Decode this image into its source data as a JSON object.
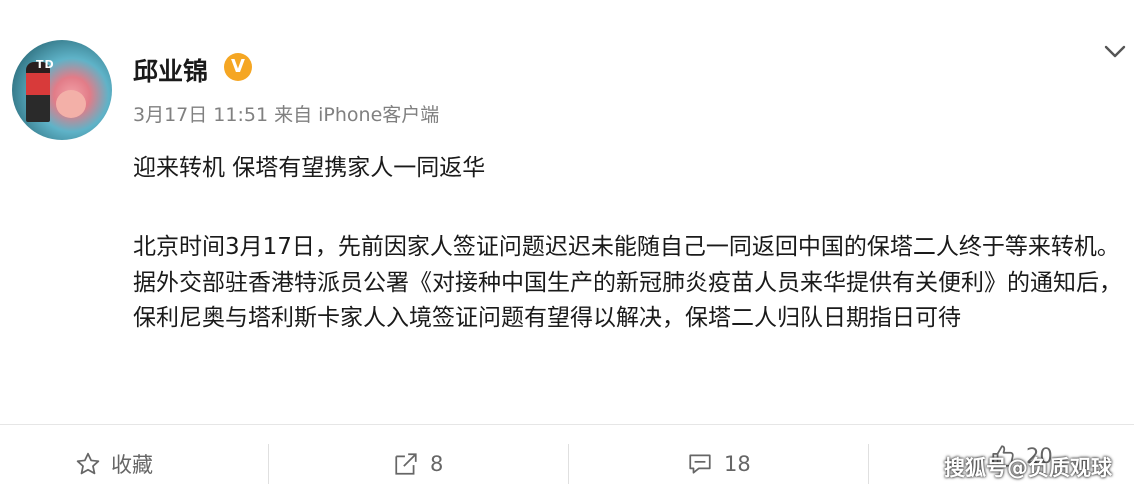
{
  "post": {
    "author": "邱业锦",
    "verified_badge": "V",
    "meta": "3月17日 11:51 来自 iPhone客户端",
    "title": "迎来转机 保塔有望携家人一同返华",
    "body": "北京时间3月17日，先前因家人签证问题迟迟未能随自己一同返回中国的保塔二人终于等来转机。据外交部驻香港特派员公署《对接种中国生产的新冠肺炎疫苗人员来华提供有关便利》的通知后，保利尼奥与塔利斯卡家人入境签证问题有望得以解决，保塔二人归队日期指日可待",
    "avatar_text": "TD",
    "accent": "#f5a623"
  },
  "actions": {
    "favorite_label": "收藏",
    "repost_count": "8",
    "comment_count": "18",
    "like_count": "20"
  },
  "watermark": "搜狐号@负质观球"
}
